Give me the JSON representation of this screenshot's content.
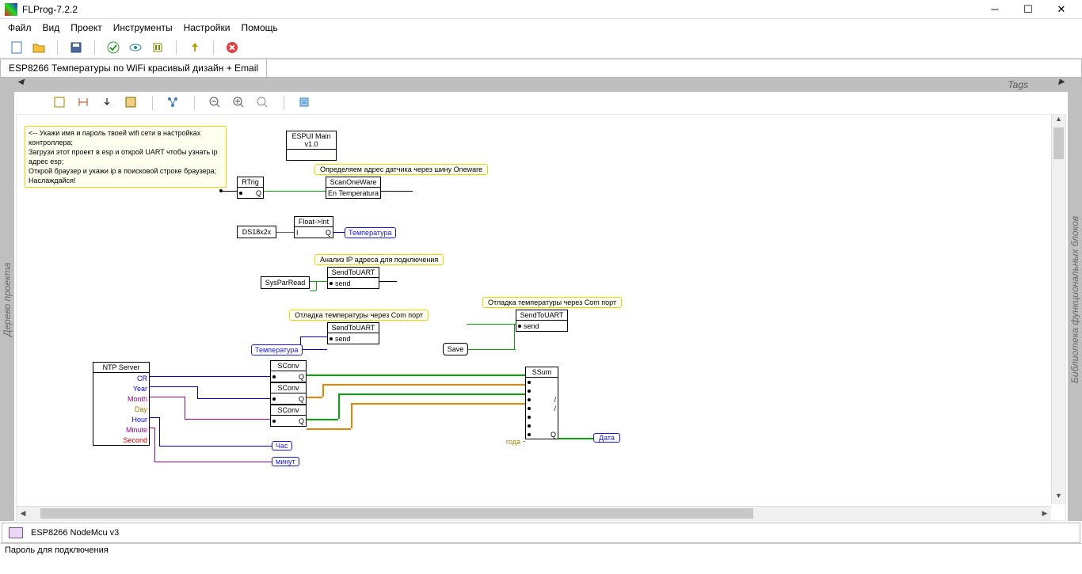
{
  "window": {
    "title": "FLProg-7.2.2"
  },
  "menu": {
    "file": "Файл",
    "view": "Вид",
    "project": "Проект",
    "tools": "Инструменты",
    "settings": "Настройки",
    "help": "Помощь"
  },
  "tabs": {
    "main": "ESP8266  Температуры по WiFi красивый дизайн + Email"
  },
  "panels": {
    "left": "Дерево проекта",
    "right": "Библиотека функциональных блоков",
    "tags": "Tags"
  },
  "footer": {
    "device": "ESP8266 NodeMcu v3"
  },
  "status": {
    "text": "Пароль для подключения"
  },
  "notes": {
    "big1": "<-- Укажи имя и пароль твоей wifi сети в настройках контроллера;",
    "big2": "Загрузи этот проект в esp и открой UART чтобы узнать ip адрес esp;",
    "big3": "Открой браузер и укажи ip в поисковой строке браузера;",
    "big4": "Наслаждайся!",
    "espui": "ESPUI Main v1.0",
    "oneware": "Определяем адрес датчика через шину Oneware",
    "ipanalysis": "Анализ IP адреса для подключения",
    "debug1": "Отладка температуры через Com порт",
    "debug2": "Отладка температуры через Com порт"
  },
  "blocks": {
    "rtrig": {
      "title": "RTrig",
      "in": "",
      "out": ""
    },
    "scan": {
      "title": "ScanOneWare",
      "in": "En",
      "out": "Temperatura"
    },
    "ds18": "DS18x2x",
    "float2int": {
      "title": "Float->Int",
      "in": "I",
      "out": "Q"
    },
    "tempOut": "Температура",
    "syspar": "SysParRead",
    "send1": {
      "title": "SendToUART",
      "in": "send"
    },
    "send2": {
      "title": "SendToUART",
      "in": "send"
    },
    "send3": {
      "title": "SendToUART",
      "in": "send"
    },
    "tempIn": "Температура",
    "save": "Save",
    "ntp": {
      "title": "NTP Server",
      "rows": [
        "CR",
        "Year",
        "Month",
        "Day",
        "Hour",
        "Minute",
        "Second"
      ]
    },
    "sconv": "SConv",
    "ssum": "SSum",
    "hour": "Час",
    "minute": "минут",
    "year": "года",
    "date": "Дата"
  }
}
